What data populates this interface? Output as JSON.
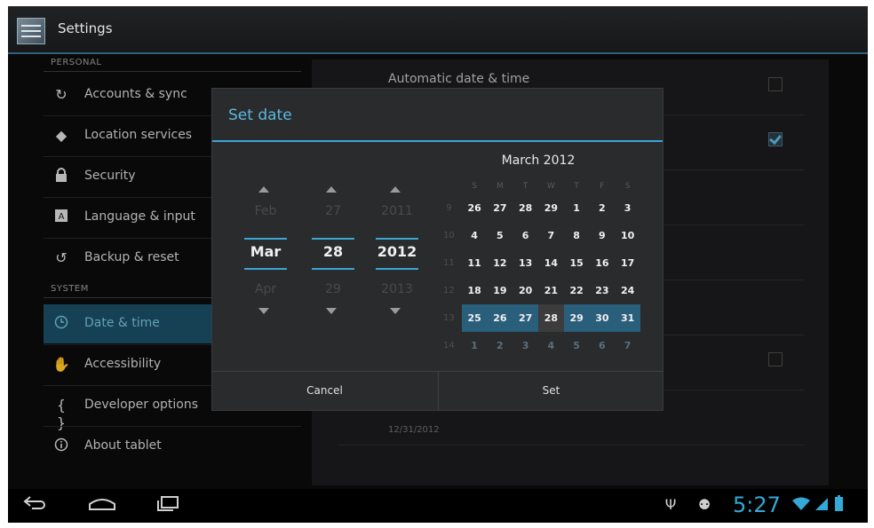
{
  "app": {
    "title": "Settings",
    "icon": "settings-app-icon"
  },
  "sidebar": {
    "personal_header": "PERSONAL",
    "system_header": "SYSTEM",
    "items": [
      {
        "label": "Accounts & sync",
        "icon": "sync-icon"
      },
      {
        "label": "Location services",
        "icon": "location-icon"
      },
      {
        "label": "Security",
        "icon": "lock-icon"
      },
      {
        "label": "Language & input",
        "icon": "keyboard-icon"
      },
      {
        "label": "Backup & reset",
        "icon": "backup-icon"
      },
      {
        "label": "Date & time",
        "icon": "clock-icon",
        "selected": true
      },
      {
        "label": "Accessibility",
        "icon": "hand-icon"
      },
      {
        "label": "Developer options",
        "icon": "braces-icon"
      },
      {
        "label": "About tablet",
        "icon": "info-icon"
      }
    ]
  },
  "content": {
    "automatic_date_time": {
      "title": "Automatic date & time",
      "checked": false
    },
    "automatic_time_zone": {
      "checked": true
    },
    "hour_format": {
      "checked": false
    },
    "date_format_summary": "12/31/2012"
  },
  "dialog": {
    "title": "Set date",
    "month": {
      "prev": "Feb",
      "current": "Mar",
      "next": "Apr"
    },
    "day": {
      "prev": "27",
      "current": "28",
      "next": "29"
    },
    "year": {
      "prev": "2011",
      "current": "2012",
      "next": "2013"
    },
    "calendar": {
      "month_label": "March 2012",
      "weekdays": [
        "S",
        "M",
        "T",
        "W",
        "T",
        "F",
        "S"
      ],
      "weeks": [
        {
          "num": "9",
          "days": [
            "26",
            "27",
            "28",
            "29",
            "1",
            "2",
            "3"
          ]
        },
        {
          "num": "10",
          "days": [
            "4",
            "5",
            "6",
            "7",
            "8",
            "9",
            "10"
          ]
        },
        {
          "num": "11",
          "days": [
            "11",
            "12",
            "13",
            "14",
            "15",
            "16",
            "17"
          ]
        },
        {
          "num": "12",
          "days": [
            "18",
            "19",
            "20",
            "21",
            "22",
            "23",
            "24"
          ]
        },
        {
          "num": "13",
          "days": [
            "25",
            "26",
            "27",
            "28",
            "29",
            "30",
            "31"
          ]
        },
        {
          "num": "14",
          "days": [
            "1",
            "2",
            "3",
            "4",
            "5",
            "6",
            "7"
          ]
        }
      ],
      "selected_day": "28"
    },
    "cancel_label": "Cancel",
    "set_label": "Set"
  },
  "statusbar": {
    "time": "5:27",
    "accent": "#34a8d6"
  }
}
